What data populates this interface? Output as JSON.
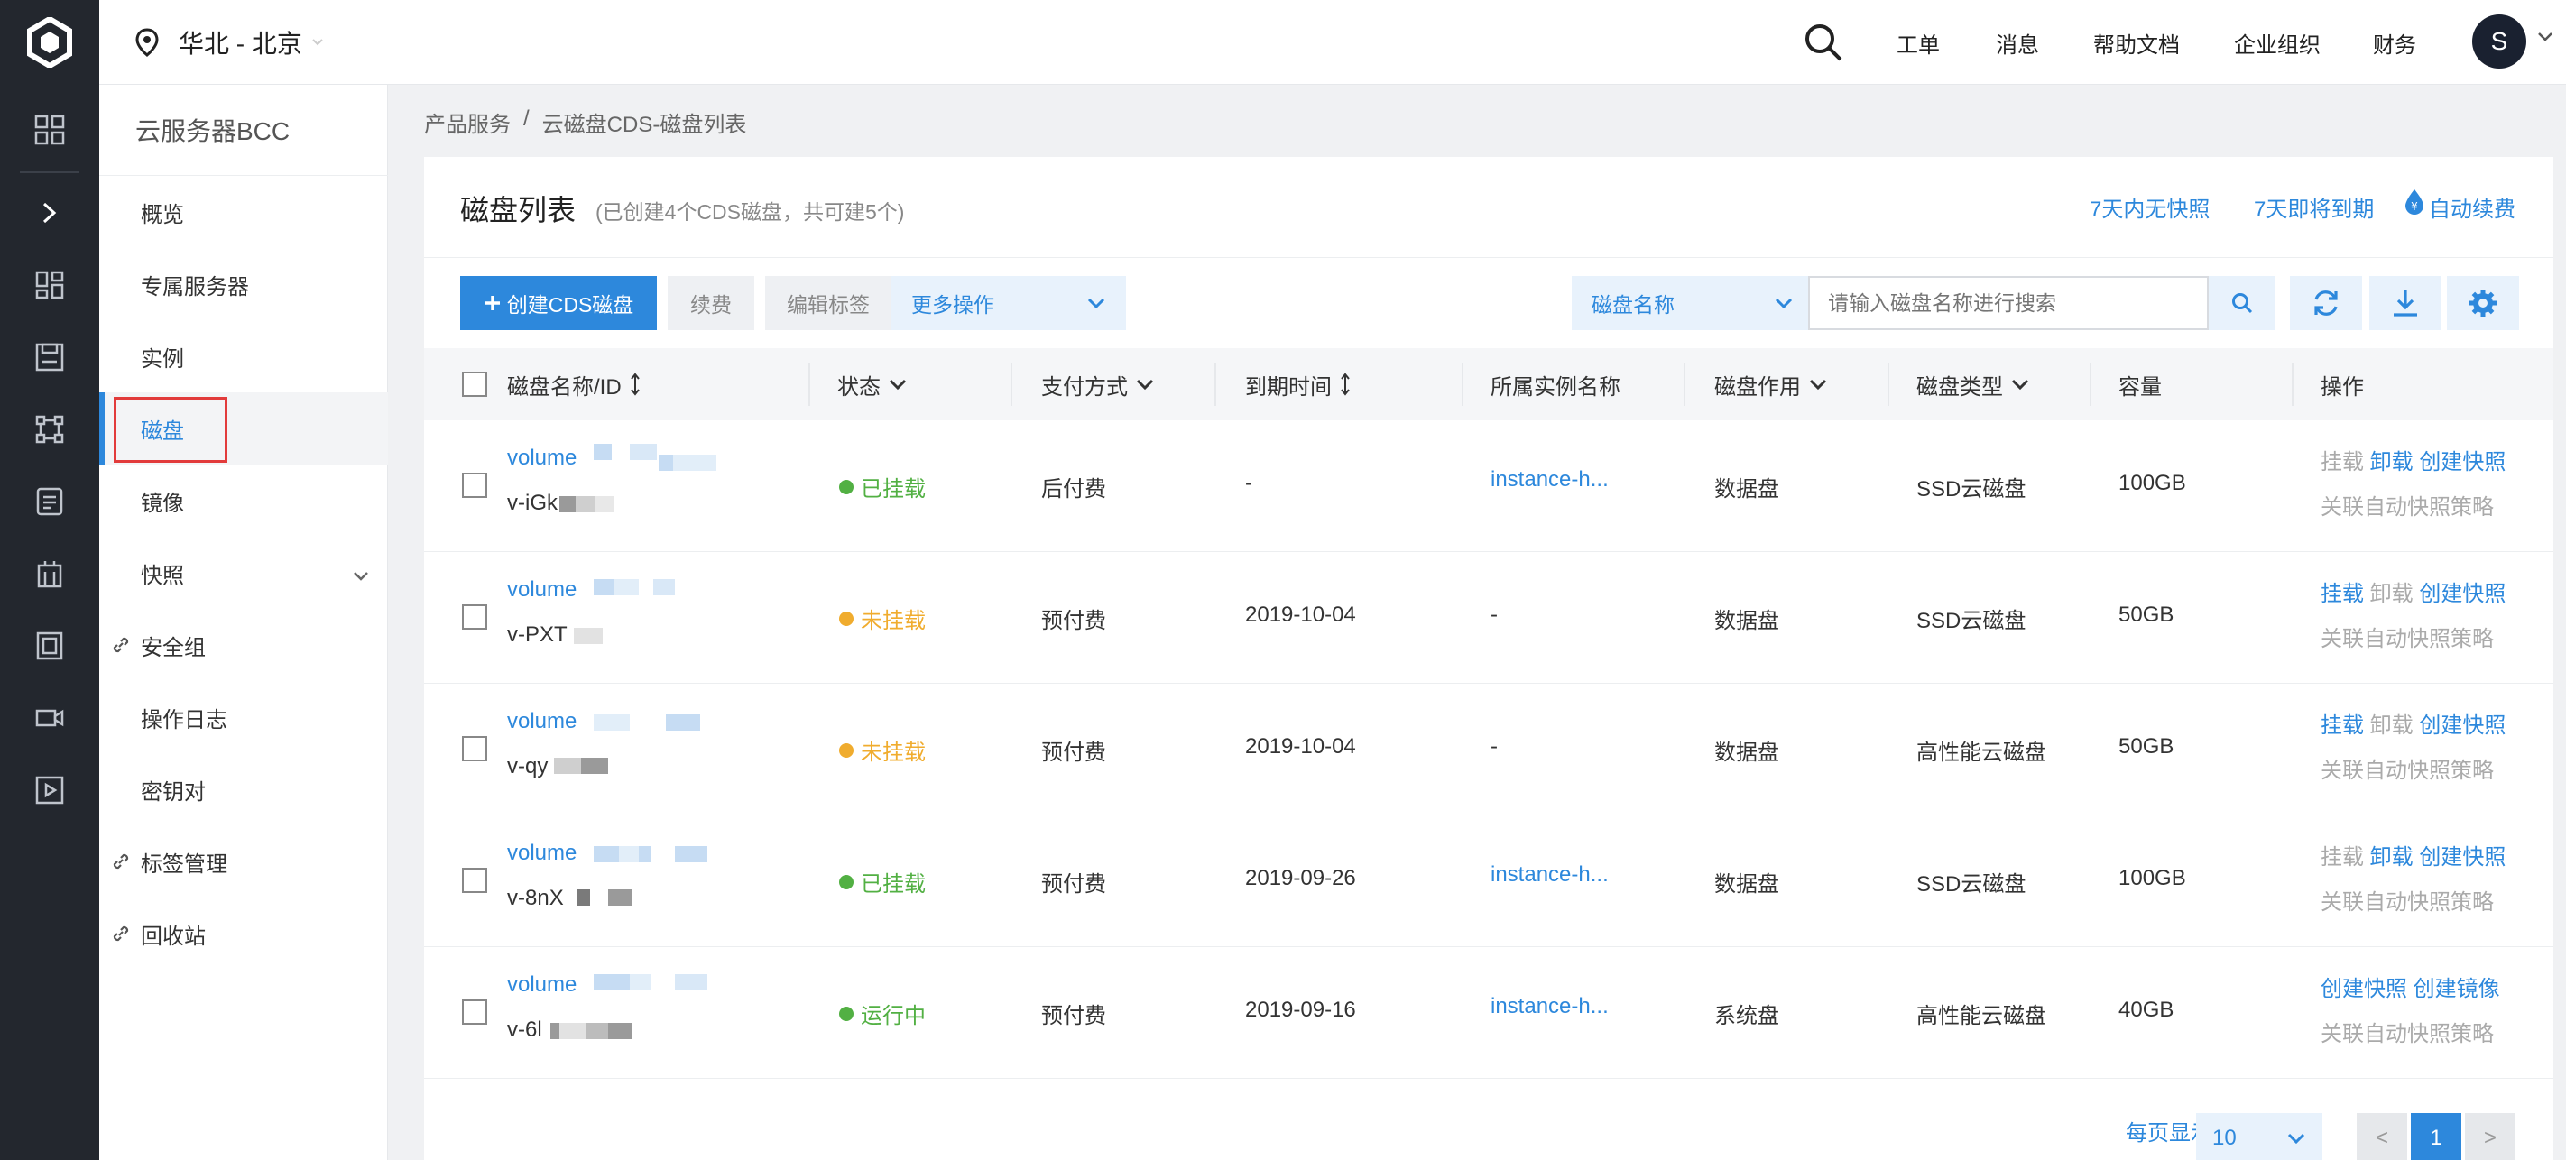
{
  "topbar": {
    "region": "华北 - 北京",
    "nav": [
      "工单",
      "消息",
      "帮助文档",
      "企业组织",
      "财务"
    ],
    "avatar_letter": "S"
  },
  "rail": {
    "icons": [
      "logo-icon",
      "grid-icon",
      "expand-chevron-icon",
      "dashboard-icon",
      "save-icon",
      "network-icon",
      "document-icon",
      "building-icon",
      "book-icon",
      "video-icon",
      "play-icon"
    ]
  },
  "sidebar": {
    "title": "云服务器BCC",
    "items": [
      {
        "label": "概览"
      },
      {
        "label": "专属服务器"
      },
      {
        "label": "实例"
      },
      {
        "label": "磁盘"
      },
      {
        "label": "镜像"
      },
      {
        "label": "快照"
      },
      {
        "label": "安全组"
      },
      {
        "label": "操作日志"
      },
      {
        "label": "密钥对"
      },
      {
        "label": "标签管理"
      },
      {
        "label": "回收站"
      }
    ]
  },
  "breadcrumb": {
    "root": "产品服务",
    "sep": "/",
    "current": "云磁盘CDS-磁盘列表"
  },
  "card": {
    "title": "磁盘列表",
    "subtitle": "(已创建4个CDS磁盘，共可建5个)",
    "links": [
      "7天内无快照",
      "7天即将到期",
      "自动续费"
    ]
  },
  "toolbar": {
    "create": "创建CDS磁盘",
    "renew": "续费",
    "edit_tags": "编辑标签",
    "more": "更多操作"
  },
  "filter": {
    "field": "磁盘名称",
    "placeholder": "请输入磁盘名称进行搜索"
  },
  "table": {
    "headers": [
      "磁盘名称/ID",
      "状态",
      "支付方式",
      "到期时间",
      "所属实例名称",
      "磁盘作用",
      "磁盘类型",
      "容量",
      "操作"
    ],
    "rows": [
      {
        "name": "volume",
        "id": "v-iGk",
        "status": "已挂载",
        "status_color": "#52b043",
        "pay": "后付费",
        "expire": "-",
        "instance": "instance-h...",
        "role": "数据盘",
        "type": "SSD云磁盘",
        "size": "100GB",
        "ops": [
          {
            "t": "挂载",
            "on": false
          },
          {
            "t": "卸载",
            "on": true
          },
          {
            "t": "创建快照",
            "on": true
          }
        ],
        "op2": "关联自动快照策略"
      },
      {
        "name": "volume",
        "id": "v-PXT",
        "status": "未挂载",
        "status_color": "#f0ac2e",
        "pay": "预付费",
        "expire": "2019-10-04",
        "instance": "-",
        "role": "数据盘",
        "type": "SSD云磁盘",
        "size": "50GB",
        "ops": [
          {
            "t": "挂载",
            "on": true
          },
          {
            "t": "卸载",
            "on": false
          },
          {
            "t": "创建快照",
            "on": true
          }
        ],
        "op2": "关联自动快照策略"
      },
      {
        "name": "volume",
        "id": "v-qy",
        "status": "未挂载",
        "status_color": "#f0ac2e",
        "pay": "预付费",
        "expire": "2019-10-04",
        "instance": "-",
        "role": "数据盘",
        "type": "高性能云磁盘",
        "size": "50GB",
        "ops": [
          {
            "t": "挂载",
            "on": true
          },
          {
            "t": "卸载",
            "on": false
          },
          {
            "t": "创建快照",
            "on": true
          }
        ],
        "op2": "关联自动快照策略"
      },
      {
        "name": "volume",
        "id": "v-8nX",
        "status": "已挂载",
        "status_color": "#52b043",
        "pay": "预付费",
        "expire": "2019-09-26",
        "instance": "instance-h...",
        "role": "数据盘",
        "type": "SSD云磁盘",
        "size": "100GB",
        "ops": [
          {
            "t": "挂载",
            "on": false
          },
          {
            "t": "卸载",
            "on": true
          },
          {
            "t": "创建快照",
            "on": true
          }
        ],
        "op2": "关联自动快照策略"
      },
      {
        "name": "volume",
        "id": "v-6l",
        "status": "运行中",
        "status_color": "#52b043",
        "pay": "预付费",
        "expire": "2019-09-16",
        "instance": "instance-h...",
        "role": "系统盘",
        "type": "高性能云磁盘",
        "size": "40GB",
        "ops": [
          {
            "t": "创建快照",
            "on": true
          },
          {
            "t": "创建镜像",
            "on": true
          }
        ],
        "op2": "关联自动快照策略"
      }
    ]
  },
  "pagination": {
    "per_page_label": "每页显示",
    "per_page": "10",
    "prev": "<",
    "current": "1",
    "next": ">"
  },
  "colors": {
    "accent": "#2d88dc",
    "rail": "#23272e",
    "highlight_box": "#e23b3b"
  }
}
